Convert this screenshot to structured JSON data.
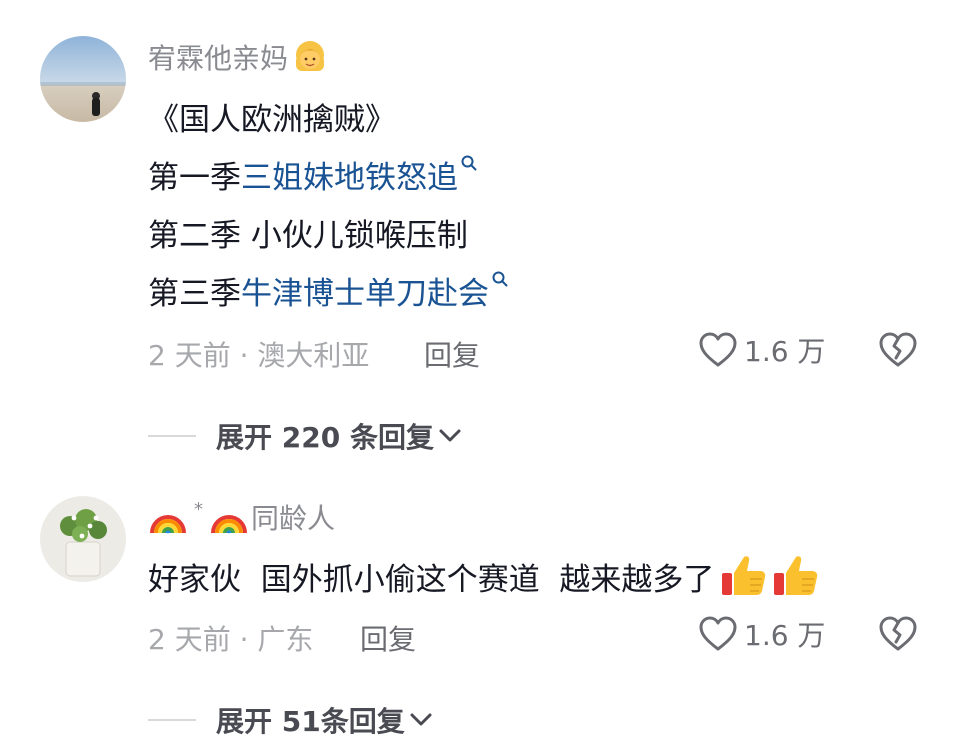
{
  "comments": [
    {
      "username": "宥霖他亲妈",
      "username_emoji": "woman-emoji",
      "lines": [
        {
          "prefix": "《国人欧洲擒贼》",
          "link": ""
        },
        {
          "prefix": "第一季 ",
          "link": "三姐妹地铁怒追"
        },
        {
          "prefix": "第二季 小伙儿锁喉压制",
          "link": ""
        },
        {
          "prefix": "第三季 ",
          "link": "牛津博士单刀赴会"
        }
      ],
      "meta": "2 天前 · 澳大利亚",
      "reply_label": "回复",
      "likes": "1.6 万",
      "expand_label": "展开 220 条回复"
    },
    {
      "username": "同龄人",
      "username_separator": "*",
      "text": "好家伙  国外抓小偷这个赛道  越来越多了",
      "meta": "2 天前 · 广东",
      "reply_label": "回复",
      "likes": "1.6 万",
      "expand_label": "展开 51条回复"
    }
  ],
  "icons": {
    "like": "heart-outline-icon",
    "dislike": "broken-heart-icon",
    "expand": "chevron-down-icon",
    "search": "search-icon",
    "rainbow": "rainbow-emoji",
    "thumbs_up": "thumbs-up-emoji"
  },
  "colors": {
    "link": "#1a5393",
    "username": "#8a8b91",
    "meta": "#a7a8ac",
    "text": "#161823"
  }
}
